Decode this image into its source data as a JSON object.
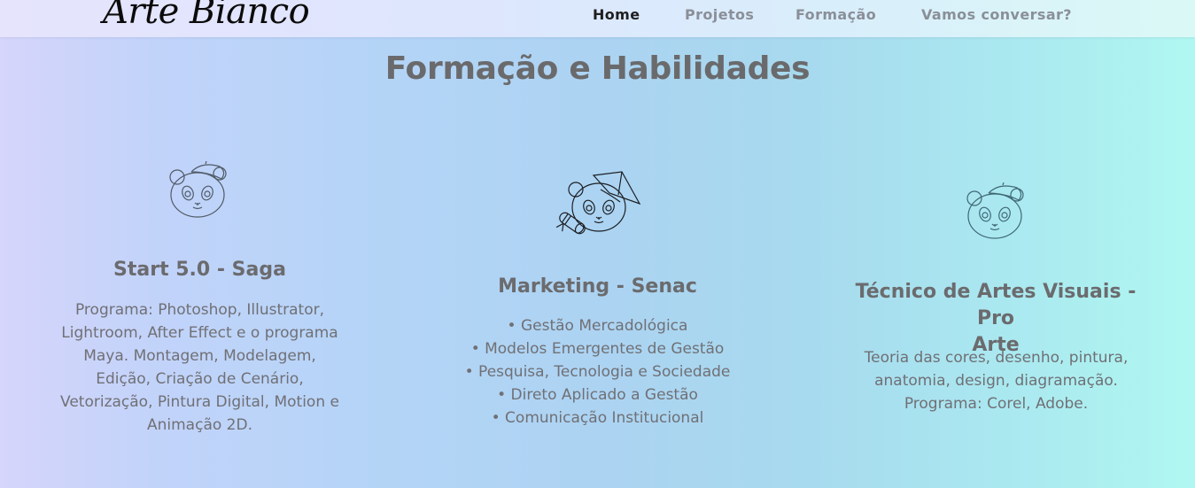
{
  "header": {
    "logo_text": "Arte Bianco",
    "nav": [
      {
        "label": "Home",
        "active": true
      },
      {
        "label": "Projetos",
        "active": false
      },
      {
        "label": "Formação",
        "active": false
      },
      {
        "label": "Vamos conversar?",
        "active": false
      }
    ]
  },
  "section": {
    "title": "Formação e Habilidades"
  },
  "cards": [
    {
      "icon": "panda-beret-icon",
      "title": "Start 5.0 - Saga",
      "lines": [
        "Programa: Photoshop, Illustrator,",
        "Lightroom, After Effect e o programa",
        "Maya. Montagem, Modelagem,",
        "Edição, Criação de Cenário,",
        "Vetorização, Pintura Digital, Motion e",
        "Animação 2D."
      ]
    },
    {
      "icon": "panda-graduate-icon",
      "title": "Marketing - Senac",
      "lines": [
        "• Gestão Mercadológica",
        "• Modelos Emergentes de Gestão",
        "• Pesquisa, Tecnologia e Sociedade",
        "• Direto Aplicado a Gestão",
        "• Comunicação Institucional"
      ]
    },
    {
      "icon": "panda-beret-icon",
      "title_lines": [
        "Técnico de Artes Visuais - Pro",
        "Arte"
      ],
      "lines": [
        "Teoria das cores, desenho, pintura,",
        "anatomia, design, diagramação.",
        "Programa: Corel, Adobe."
      ]
    }
  ]
}
